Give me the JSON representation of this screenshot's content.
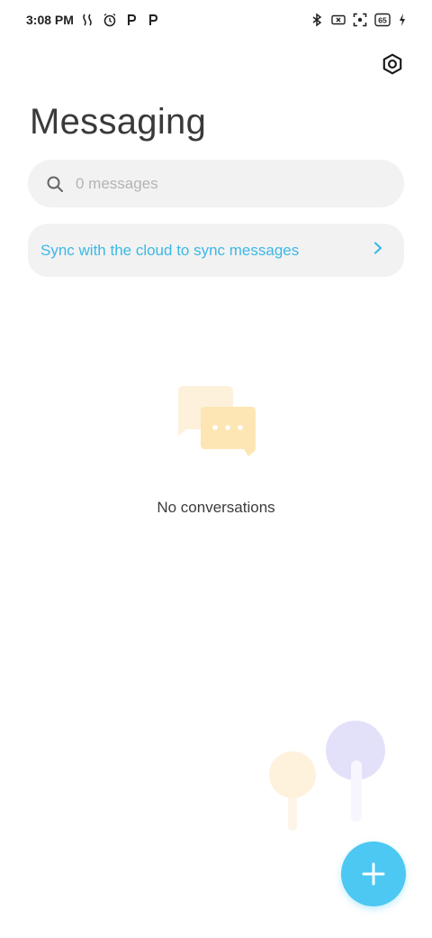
{
  "status_bar": {
    "time": "3:08 PM",
    "battery": "65",
    "left_icons": [
      "vibration-icon",
      "alarm-icon",
      "parking-icon",
      "parking-icon"
    ],
    "right_icons": [
      "bluetooth-icon",
      "no-sim-icon",
      "screen-record-icon",
      "battery-icon",
      "charging-icon"
    ]
  },
  "header": {
    "title": "Messaging",
    "settings_icon": "settings-hexagon-icon"
  },
  "search": {
    "placeholder": "0 messages",
    "value": ""
  },
  "sync_banner": {
    "text": "Sync with the cloud to sync messages",
    "color": "#3cb8e6"
  },
  "empty_state": {
    "text": "No conversations",
    "icon": "chat-bubbles-icon"
  },
  "fab": {
    "icon": "plus-icon",
    "color": "#4cc8f2"
  }
}
